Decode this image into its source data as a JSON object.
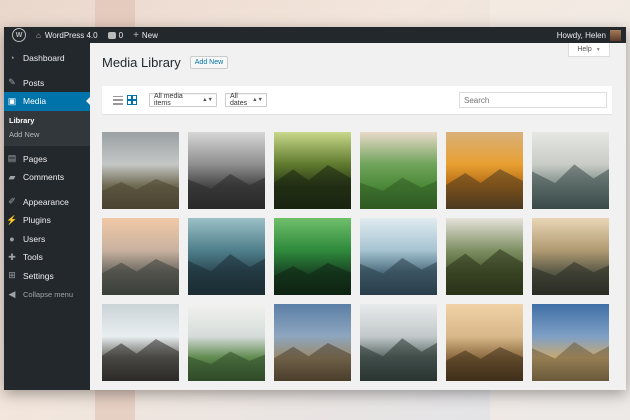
{
  "adminbar": {
    "site_name": "WordPress 4.0",
    "comments_count": "0",
    "new_label": "New",
    "greeting": "Howdy, Helen"
  },
  "sidebar": {
    "dashboard": "Dashboard",
    "posts": "Posts",
    "media": "Media",
    "library": "Library",
    "add_new": "Add New",
    "pages": "Pages",
    "comments": "Comments",
    "appearance": "Appearance",
    "plugins": "Plugins",
    "users": "Users",
    "tools": "Tools",
    "settings": "Settings",
    "collapse": "Collapse menu"
  },
  "header": {
    "help_label": "Help",
    "title": "Media Library",
    "add_new_label": "Add New"
  },
  "toolbar": {
    "filter_type": "All media items",
    "filter_date": "All dates",
    "search_placeholder": "Search"
  },
  "colors": {
    "adminbar": "#23282d",
    "sidebar": "#23282d",
    "accent": "#0073aa",
    "content_bg": "#f1f1f1"
  },
  "media_items": [
    {
      "name": "misty-field",
      "colors": [
        "#9aa0a3",
        "#c4c7c6",
        "#6f6a52",
        "#4a4432"
      ]
    },
    {
      "name": "snowy-mountains-bw",
      "colors": [
        "#d6d6d6",
        "#8f8f8f",
        "#474747",
        "#2a2a2a"
      ]
    },
    {
      "name": "forest-sunlight",
      "colors": [
        "#c9d88a",
        "#5f7a2e",
        "#2b3a18",
        "#1a2410"
      ]
    },
    {
      "name": "green-valley",
      "colors": [
        "#e9d9c9",
        "#6fa45a",
        "#4d8a3a",
        "#2f5a22"
      ]
    },
    {
      "name": "cactus-spines",
      "colors": [
        "#d9b07a",
        "#e8a032",
        "#b36a14",
        "#4a3a20"
      ]
    },
    {
      "name": "frosted-trees",
      "colors": [
        "#e6e7e3",
        "#c9ccc6",
        "#7b8a86",
        "#3a4a48"
      ]
    },
    {
      "name": "cliff-sunset",
      "colors": [
        "#f1c8a6",
        "#c9b2a0",
        "#6e6a62",
        "#3b3f3a"
      ]
    },
    {
      "name": "mountain-lake",
      "colors": [
        "#9cc0c6",
        "#4f7f8c",
        "#2d4a55",
        "#1c2c33"
      ]
    },
    {
      "name": "green-leaves",
      "colors": [
        "#6fbf6a",
        "#2f8a3c",
        "#1b4a26",
        "#0e2212"
      ]
    },
    {
      "name": "sea-clouds",
      "colors": [
        "#e0ebf0",
        "#a6c4d2",
        "#4f6f80",
        "#2a3e4a"
      ]
    },
    {
      "name": "hill-cabin",
      "colors": [
        "#e6e2da",
        "#7d8f62",
        "#4a5a32",
        "#2a3218"
      ]
    },
    {
      "name": "dusk-tree",
      "colors": [
        "#e9d6b6",
        "#b09a72",
        "#5a5a48",
        "#2a2c24"
      ]
    },
    {
      "name": "waves-rocks",
      "colors": [
        "#c9d3d6",
        "#e9eef0",
        "#6a6a62",
        "#2c2a28"
      ]
    },
    {
      "name": "snowy-hill",
      "colors": [
        "#f2f2f0",
        "#d5dcd9",
        "#5f8a4f",
        "#2f4a28"
      ]
    },
    {
      "name": "country-road",
      "colors": [
        "#5b7fa6",
        "#8ea6bf",
        "#9a8a6a",
        "#4a3e2c"
      ]
    },
    {
      "name": "foggy-pines",
      "colors": [
        "#e8ebec",
        "#c2c8ca",
        "#5a6a66",
        "#2a3432"
      ]
    },
    {
      "name": "coastal-rock",
      "colors": [
        "#f0d2a6",
        "#d9b88a",
        "#8a6a3e",
        "#3e2e1a"
      ]
    },
    {
      "name": "blue-dune",
      "colors": [
        "#3f6fa6",
        "#7fa0c6",
        "#c9a870",
        "#6a5a3a"
      ]
    }
  ]
}
